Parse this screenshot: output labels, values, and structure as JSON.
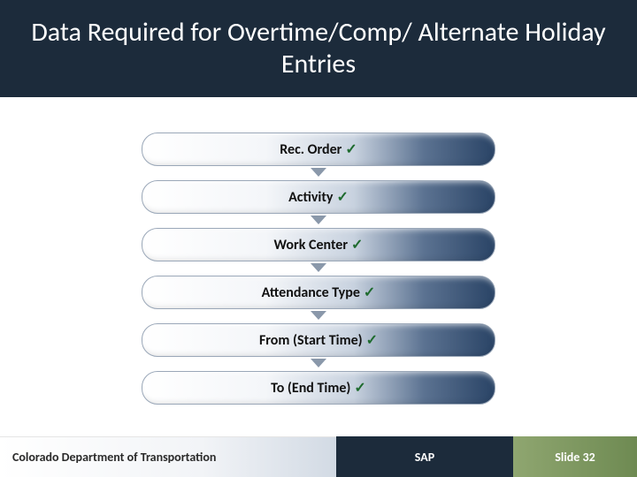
{
  "title": "Data Required for Overtime/Comp/ Alternate Holiday Entries",
  "steps": [
    {
      "label": "Rec. Order"
    },
    {
      "label": "Activity"
    },
    {
      "label": "Work Center"
    },
    {
      "label": "Attendance Type"
    },
    {
      "label": "From (Start Time)"
    },
    {
      "label": "To (End Time)"
    }
  ],
  "check_glyph": "✓",
  "footer": {
    "org": "Colorado Department of Transportation",
    "system": "SAP",
    "slide": "Slide 32"
  }
}
